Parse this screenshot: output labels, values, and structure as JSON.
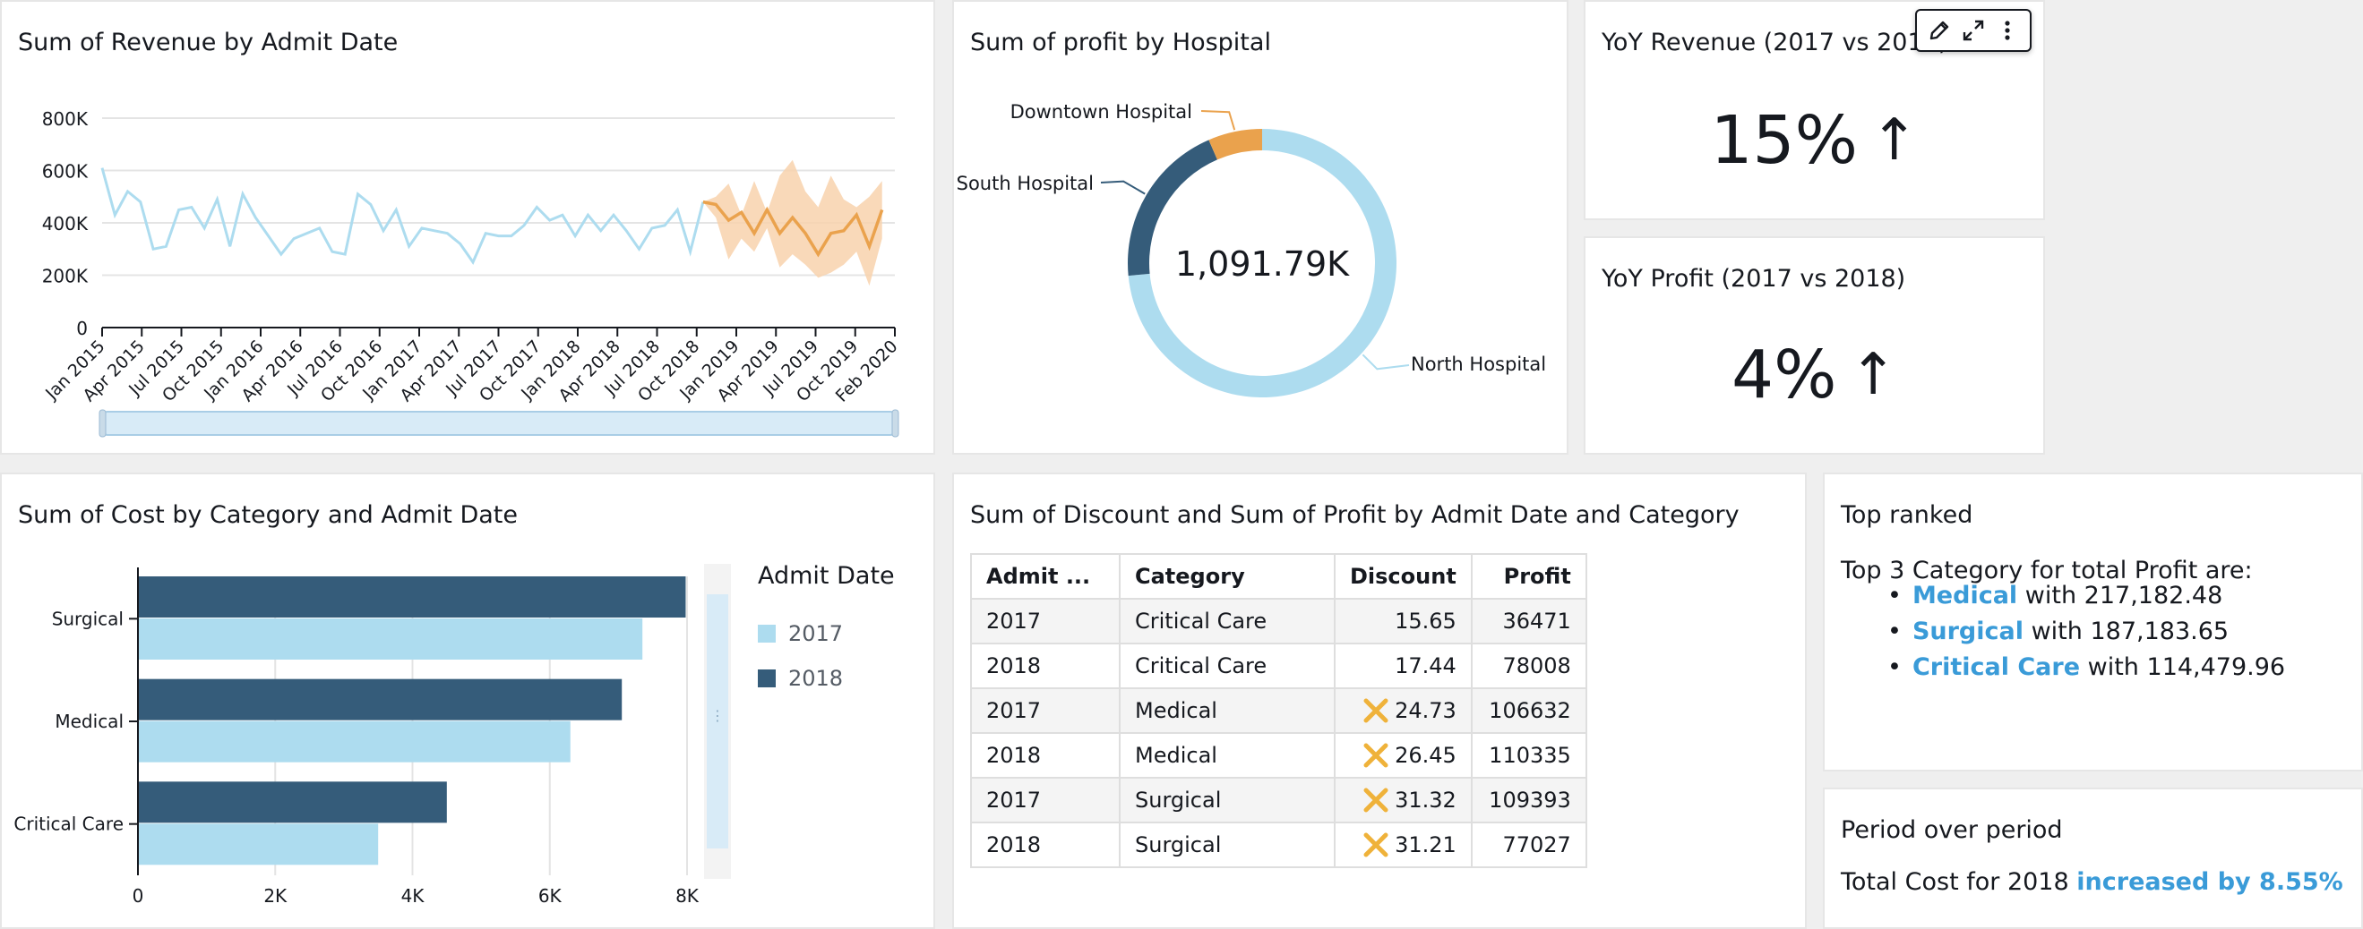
{
  "colors": {
    "light_blue": "#addcef",
    "dark_blue": "#355c7a",
    "orange": "#eaa24d",
    "forecast_band": "#f8d2ad",
    "highlight_blue": "#3a9bd8",
    "warning_orange": "#efb23a"
  },
  "revenue_card": {
    "title": "Sum of Revenue by Admit Date",
    "chart_data": {
      "type": "line",
      "title": "Sum of Revenue by Admit Date",
      "y_ticks": [
        "0",
        "200K",
        "400K",
        "600K",
        "800K"
      ],
      "ylim": [
        0,
        800000
      ],
      "x_tick_labels": [
        "Jan 2015",
        "Apr 2015",
        "Jul 2015",
        "Oct 2015",
        "Jan 2016",
        "Apr 2016",
        "Jul 2016",
        "Oct 2016",
        "Jan 2017",
        "Apr 2017",
        "Jul 2017",
        "Oct 2017",
        "Jan 2018",
        "Apr 2018",
        "Jul 2018",
        "Oct 2018",
        "Jan 2019",
        "Apr 2019",
        "Jul 2019",
        "Oct 2019",
        "Feb 2020"
      ],
      "series": [
        {
          "values": [
            610000,
            430000,
            520000,
            480000,
            300000,
            310000,
            450000,
            460000,
            380000,
            490000,
            310000,
            510000,
            420000,
            350000,
            280000,
            340000,
            360000,
            380000,
            290000,
            280000,
            510000,
            470000,
            370000,
            450000,
            310000,
            380000,
            370000,
            360000,
            320000,
            250000,
            360000,
            350000,
            350000,
            390000,
            460000,
            410000,
            430000,
            350000,
            430000,
            370000,
            430000,
            370000,
            300000,
            380000,
            390000,
            450000,
            290000,
            480000
          ]
        },
        {
          "values": [
            480000,
            470000,
            410000,
            440000,
            360000,
            450000,
            360000,
            420000,
            360000,
            280000,
            360000,
            370000,
            430000,
            310000,
            450000
          ]
        }
      ],
      "forecast_band": {
        "upper": [
          480000,
          500000,
          550000,
          430000,
          560000,
          440000,
          580000,
          640000,
          520000,
          460000,
          580000,
          490000,
          460000,
          500000,
          560000
        ],
        "lower": [
          480000,
          420000,
          260000,
          340000,
          290000,
          380000,
          230000,
          280000,
          240000,
          190000,
          210000,
          240000,
          290000,
          160000,
          340000
        ]
      }
    }
  },
  "hospital_card": {
    "title": "Sum of profit by Hospital",
    "center_value": "1,091.79K",
    "chart_data": {
      "type": "pie",
      "title": "Sum of profit by Hospital",
      "slices": [
        {
          "label": "North Hospital",
          "value": 0.735,
          "color": "#addcef"
        },
        {
          "label": "South Hospital",
          "value": 0.2,
          "color": "#355c7a"
        },
        {
          "label": "Downtown Hospital",
          "value": 0.065,
          "color": "#eaa24d"
        }
      ]
    }
  },
  "kpi_revenue": {
    "title": "YoY Revenue (2017 vs 2018)",
    "value": "15%",
    "arrow_icon": "arrow-up-icon",
    "arrow": "↑"
  },
  "kpi_profit": {
    "title": "YoY Profit (2017 vs 2018)",
    "value": "4%",
    "arrow_icon": "arrow-up-icon",
    "arrow": "↑"
  },
  "visual_toolbar": {
    "edit_icon": "pencil-icon",
    "expand_icon": "expand-icon",
    "menu_icon": "more-vertical-icon"
  },
  "cost_card": {
    "title": "Sum of Cost by Category and Admit Date",
    "legend": {
      "title": "Admit Date",
      "items": [
        {
          "label": "2017",
          "color": "#addcef"
        },
        {
          "label": "2018",
          "color": "#355c7a"
        }
      ]
    },
    "chart_data": {
      "type": "bar",
      "orientation": "horizontal",
      "title": "Sum of Cost by Category and Admit Date",
      "categories": [
        "Surgical",
        "Medical",
        "Critical Care"
      ],
      "series": [
        {
          "name": "2017",
          "values": [
            7350,
            6300,
            3500
          ]
        },
        {
          "name": "2018",
          "values": [
            7980,
            7050,
            4500
          ]
        }
      ],
      "x_ticks": [
        "0",
        "2K",
        "4K",
        "6K",
        "8K"
      ],
      "xlim": [
        0,
        8000
      ],
      "legend": "right"
    }
  },
  "discount_table": {
    "title": "Sum of Discount and Sum of Profit by Admit Date and Category",
    "columns": [
      "Admit ...",
      "Category",
      "Discount",
      "Profit"
    ],
    "rows": [
      {
        "admit": "2017",
        "category": "Critical Care",
        "discount": "15.65",
        "profit": "36471",
        "flag": false
      },
      {
        "admit": "2018",
        "category": "Critical Care",
        "discount": "17.44",
        "profit": "78008",
        "flag": false
      },
      {
        "admit": "2017",
        "category": "Medical",
        "discount": "24.73",
        "profit": "106632",
        "flag": true
      },
      {
        "admit": "2018",
        "category": "Medical",
        "discount": "26.45",
        "profit": "110335",
        "flag": true
      },
      {
        "admit": "2017",
        "category": "Surgical",
        "discount": "31.32",
        "profit": "109393",
        "flag": true
      },
      {
        "admit": "2018",
        "category": "Surgical",
        "discount": "31.21",
        "profit": "77027",
        "flag": true
      }
    ],
    "flag_icon": "warning-x-icon"
  },
  "top_ranked": {
    "title": "Top ranked",
    "intro": "Top 3 Category for total Profit are:",
    "with": "with",
    "items": [
      {
        "name": "Medical",
        "value": "217,182.48"
      },
      {
        "name": "Surgical",
        "value": "187,183.65"
      },
      {
        "name": "Critical Care",
        "value": "114,479.96"
      }
    ]
  },
  "period": {
    "title": "Period over period",
    "text": "Total Cost for 2018",
    "highlight": "increased by 8.55%"
  }
}
